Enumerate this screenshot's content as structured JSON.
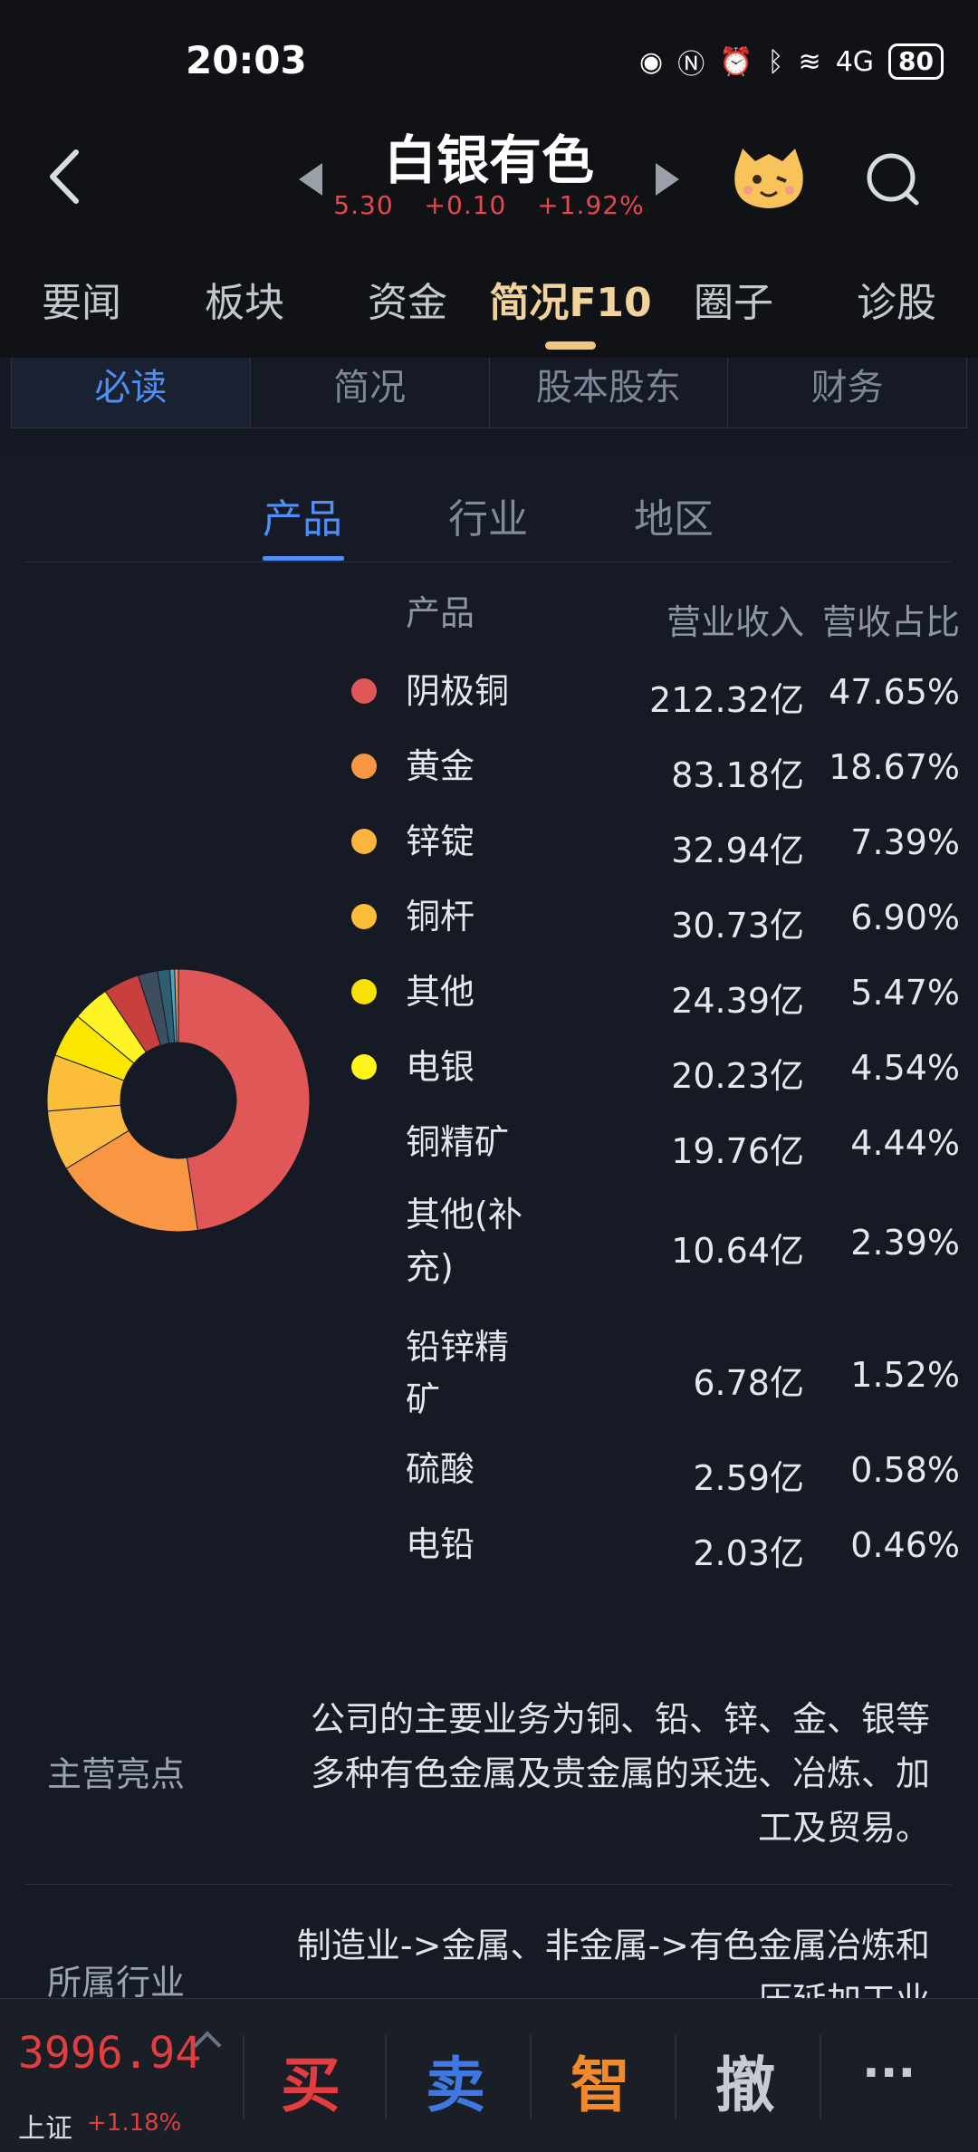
{
  "status": {
    "time": "20:03",
    "battery": "80",
    "network": "4G"
  },
  "header": {
    "title": "白银有色",
    "price": "5.30",
    "change": "+0.10",
    "change_pct": "+1.92%"
  },
  "tabs": [
    "要闻",
    "板块",
    "资金",
    "简况F10",
    "圈子",
    "诊股"
  ],
  "subtabs": [
    "必读",
    "简况",
    "股本股东",
    "财务"
  ],
  "segments": [
    "产品",
    "行业",
    "地区"
  ],
  "table": {
    "headers": {
      "name": "产品",
      "revenue": "营业收入",
      "share": "营收占比"
    },
    "rows": [
      {
        "name": "阴极铜",
        "revenue": "212.32亿",
        "share": "47.65%",
        "color": "#e05757"
      },
      {
        "name": "黄金",
        "revenue": "83.18亿",
        "share": "18.67%",
        "color": "#f99644"
      },
      {
        "name": "锌锭",
        "revenue": "32.94亿",
        "share": "7.39%",
        "color": "#fbb43c"
      },
      {
        "name": "铜杆",
        "revenue": "30.73亿",
        "share": "6.90%",
        "color": "#fcbe38"
      },
      {
        "name": "其他",
        "revenue": "24.39亿",
        "share": "5.47%",
        "color": "#f8e100"
      },
      {
        "name": "电银",
        "revenue": "20.23亿",
        "share": "4.54%",
        "color": "#fff31c"
      },
      {
        "name": "铜精矿",
        "revenue": "19.76亿",
        "share": "4.44%",
        "color": ""
      },
      {
        "name": "其他(补充)",
        "revenue": "10.64亿",
        "share": "2.39%",
        "color": ""
      },
      {
        "name": "铅锌精矿",
        "revenue": "6.78亿",
        "share": "1.52%",
        "color": ""
      },
      {
        "name": "硫酸",
        "revenue": "2.59亿",
        "share": "0.58%",
        "color": ""
      },
      {
        "name": "电铅",
        "revenue": "2.03亿",
        "share": "0.46%",
        "color": ""
      }
    ]
  },
  "chart_data": {
    "type": "pie",
    "categories": [
      "阴极铜",
      "黄金",
      "锌锭",
      "铜杆",
      "其他",
      "电银",
      "铜精矿",
      "其他(补充)",
      "铅锌精矿",
      "硫酸",
      "电铅"
    ],
    "values": [
      47.65,
      18.67,
      7.39,
      6.9,
      5.47,
      4.54,
      4.44,
      2.39,
      1.52,
      0.58,
      0.46
    ],
    "colors": [
      "#e05757",
      "#f99644",
      "#fcbb42",
      "#fdbf39",
      "#fbe600",
      "#fff225",
      "#c7403e",
      "#3b4f60",
      "#2d5f70",
      "#4aa7c6",
      "#f08f65"
    ]
  },
  "highlights": {
    "main_label": "主营亮点",
    "main_text_1": "公司的主要业务为铜、铅、锌、金、银等",
    "main_text_2": "多种有色金属及贵金属的采选、冶炼、加",
    "main_text_3": "工及贸易。",
    "industry_label": "所属行业",
    "industry_text_1": "制造业->金属、非金属->有色金属冶炼和",
    "industry_text_2": "压延加工业"
  },
  "bottom": {
    "index_value": "3996.94",
    "index_name": "上证",
    "index_change": "+1.18%",
    "actions": [
      "买",
      "卖",
      "智",
      "撤",
      "···"
    ],
    "action_colors": [
      "#e23d3f",
      "#3f78e0",
      "#f18a2c",
      "#c7cbd3",
      "#c7cbd3"
    ]
  }
}
